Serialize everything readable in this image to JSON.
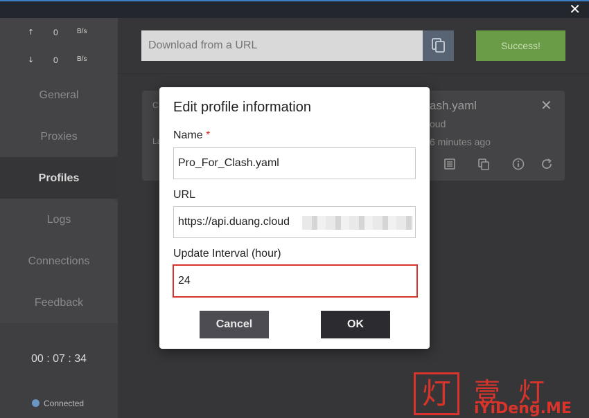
{
  "window": {
    "close_glyph": "✕"
  },
  "sidebar": {
    "upload": {
      "arrow": "↑",
      "value": "0",
      "unit": "B/s"
    },
    "download": {
      "arrow": "↓",
      "value": "0",
      "unit": "B/s"
    },
    "items": [
      {
        "label": "General"
      },
      {
        "label": "Proxies"
      },
      {
        "label": "Profiles"
      },
      {
        "label": "Logs"
      },
      {
        "label": "Connections"
      },
      {
        "label": "Feedback"
      }
    ],
    "active": "Profiles",
    "timer": "00 : 07 : 34",
    "status": "Connected",
    "status_color": "#6b96c4"
  },
  "main": {
    "url_placeholder": "Download from a URL",
    "success_label": "Success!",
    "card": {
      "left_c": "C",
      "left_l": "La",
      "title_fragment": "ash.yaml",
      "sub_fragment": "oud",
      "time_fragment": "6 minutes ago"
    }
  },
  "dialog": {
    "title": "Edit profile information",
    "name_label": "Name",
    "required_mark": "*",
    "name_value": "Pro_For_Clash.yaml",
    "url_label": "URL",
    "url_value": "https://api.duang.cloud",
    "interval_label": "Update Interval (hour)",
    "interval_value": "24",
    "cancel_label": "Cancel",
    "ok_label": "OK"
  },
  "watermark": {
    "seal_char": "灯",
    "cn_text": "壹灯",
    "url_text": "iYiDeng.ME"
  },
  "colors": {
    "accent_success": "#6a9c47",
    "highlight_red": "#d9342c",
    "copy_button": "#586474"
  }
}
